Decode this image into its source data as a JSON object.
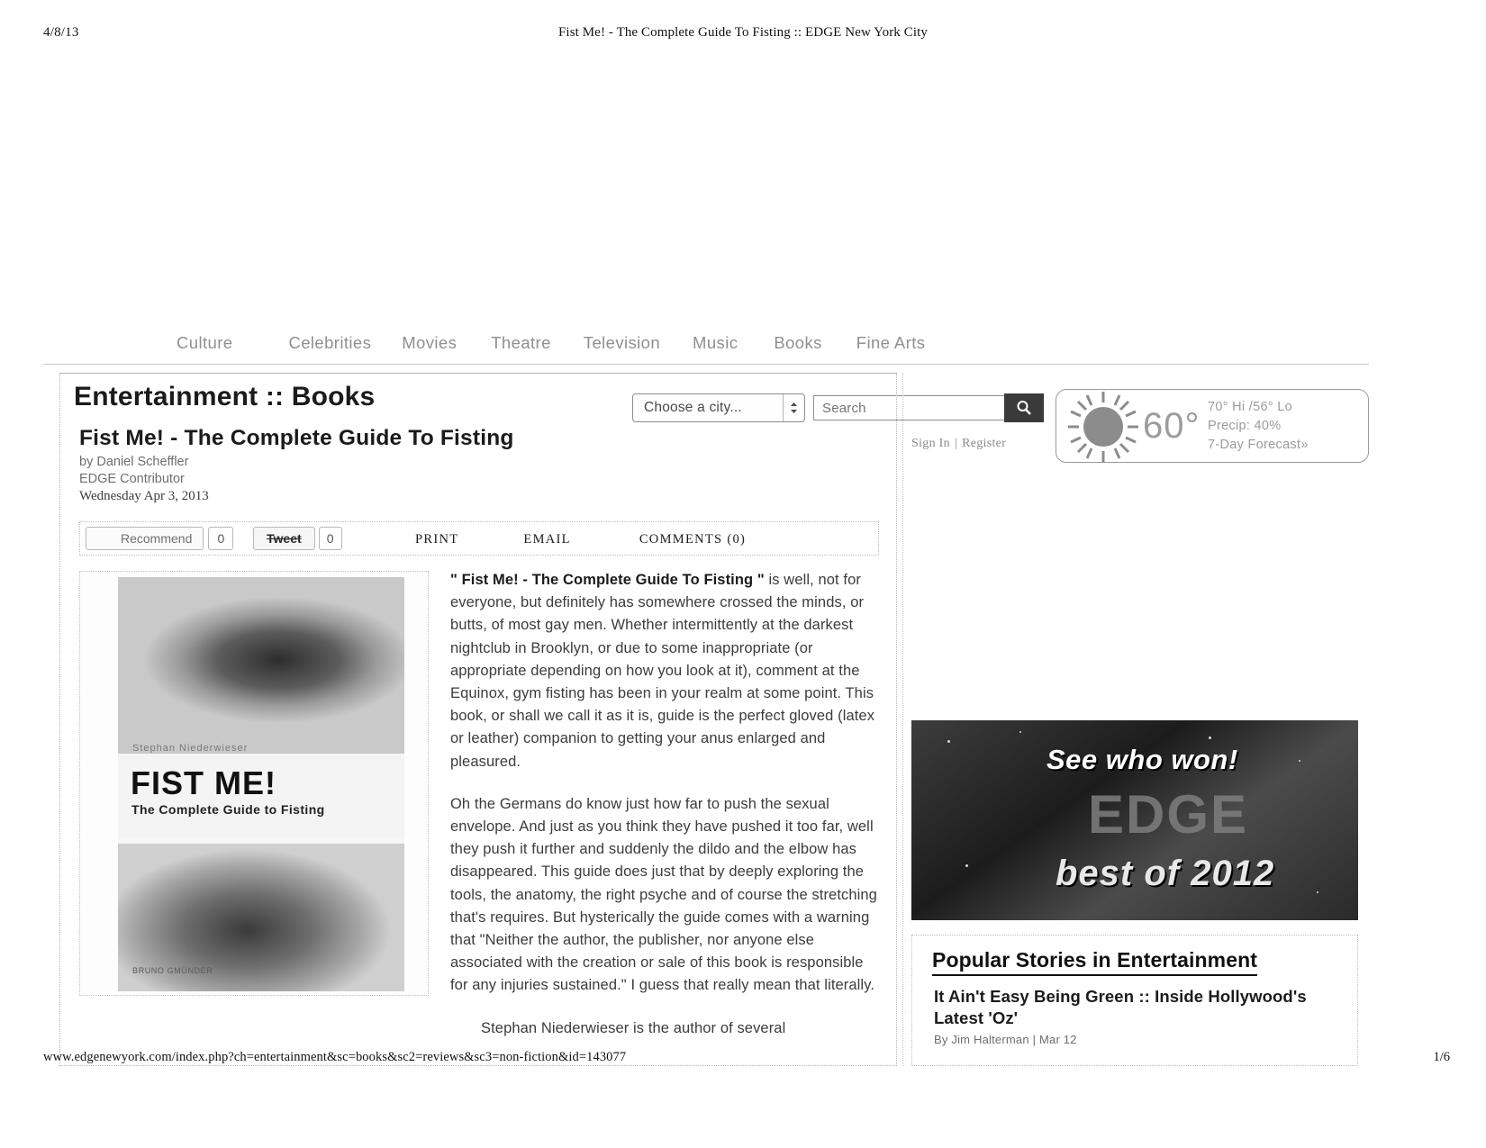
{
  "print": {
    "date": "4/8/13",
    "title": "Fist Me! - The Complete Guide To Fisting :: EDGE New York City",
    "url": "www.edgenewyork.com/index.php?ch=entertainment&sc=books&sc2=reviews&sc3=non-fiction&id=143077",
    "page": "1/6"
  },
  "utility": {
    "city_select_value": "Choose a city...",
    "search_placeholder": "Search",
    "search_value": "",
    "search_icon": "magnifier-icon",
    "sign_in": "Sign In",
    "separator": "|",
    "register": "Register"
  },
  "weather": {
    "icon": "sun-icon",
    "temperature": "60°",
    "high_low": "70° Hi /56° Lo",
    "precip": "Precip: 40%",
    "forecast_link": "7-Day Forecast»"
  },
  "nav": {
    "items": [
      {
        "label": "Culture"
      },
      {
        "label": "Celebrities"
      },
      {
        "label": "Movies"
      },
      {
        "label": "Theatre"
      },
      {
        "label": "Television"
      },
      {
        "label": "Music"
      },
      {
        "label": "Books"
      },
      {
        "label": "Fine Arts"
      }
    ]
  },
  "article": {
    "section": "Entertainment :: Books",
    "headline": "Fist Me! - The Complete Guide To Fisting",
    "author": "by Daniel Scheffler",
    "role": "EDGE Contributor",
    "date": "Wednesday Apr 3, 2013",
    "paragraphs": [
      {
        "lead_bold": "\" Fist Me! - The Complete Guide To Fisting \"",
        "text": " is well, not for everyone, but definitely has somewhere crossed the minds, or butts, of most gay men. Whether intermittently at the darkest nightclub in Brooklyn, or due to some inappropriate (or appropriate depending on how you look at it), comment at the Equinox, gym fisting has been in your realm at some point. This book, or shall we call it as it is, guide is the perfect gloved (latex or leather) companion to getting your anus enlarged and pleasured."
      },
      {
        "lead_bold": "",
        "text": "Oh the Germans do know just how far to push the sexual envelope. And just as you think they have pushed it too far, well they push it further and suddenly the dildo and the elbow has disappeared. This guide does just that by deeply exploring the tools, the anatomy, the right psyche and of course the stretching that's requires. But hysterically the guide comes with a warning that \"Neither the author, the publisher, nor anyone else associated with the creation or sale of this book is responsible for any injuries sustained.\" I guess that really mean that literally."
      },
      {
        "lead_bold": "",
        "text": "Stephan Niederwieser is the author of several"
      }
    ]
  },
  "social": {
    "recommend_label": "Recommend",
    "recommend_count": "0",
    "tweet_label": "Tweet",
    "tweet_count": "0",
    "print": "PRINT",
    "email": "EMAIL",
    "comments": "COMMENTS (0)"
  },
  "book_cover": {
    "kicker": "Stephan Niederwieser",
    "title": "FIST ME!",
    "subtitle": "The Complete Guide to Fisting",
    "author_credit": "BRUNO GMÜNDER"
  },
  "ad": {
    "line1": "See who won!",
    "line2": "EDGE",
    "line3": "best of 2012"
  },
  "popular": {
    "heading": "Popular Stories in Entertainment",
    "items": [
      {
        "title": "It Ain't Easy Being Green :: Inside Hollywood's Latest 'Oz'",
        "meta": "By Jim Halterman | Mar 12"
      }
    ]
  },
  "colors": {
    "text": "#3c3c3c",
    "muted": "#8f8f8f",
    "dark": "#1b1b1b"
  }
}
